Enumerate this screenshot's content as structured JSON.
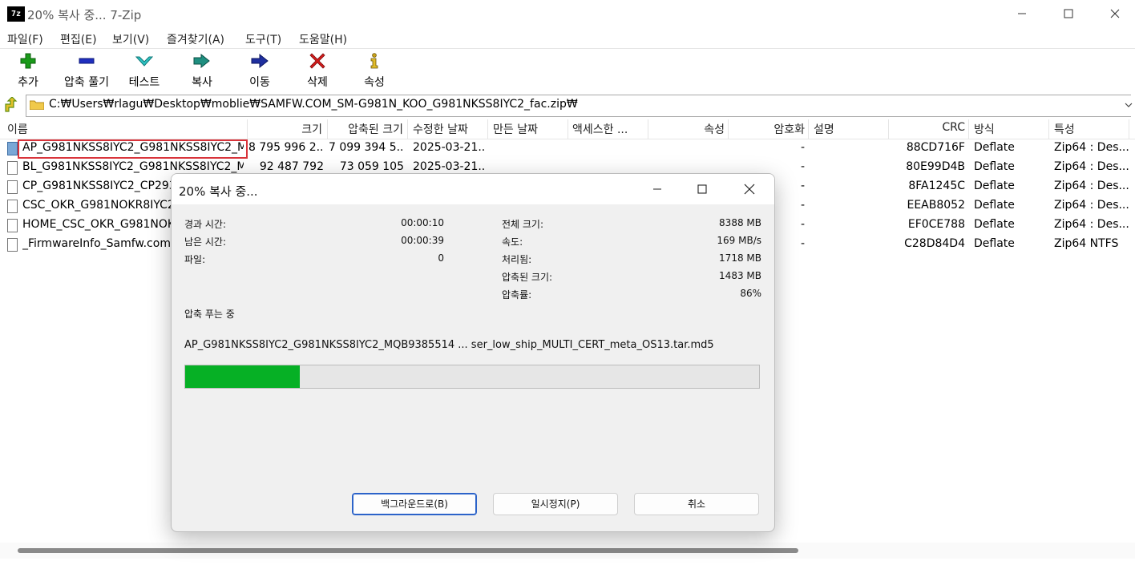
{
  "window": {
    "icon_text": "7z",
    "title": "20% 복사 중... 7-Zip"
  },
  "menu": [
    "파일(F)",
    "편집(E)",
    "보기(V)",
    "즐겨찾기(A)",
    "도구(T)",
    "도움말(H)"
  ],
  "toolbar": [
    {
      "label": "추가",
      "icon": "plus-icon",
      "color": "#1a9a1a"
    },
    {
      "label": "압축 풀기",
      "icon": "minus-icon",
      "color": "#1f2fbf"
    },
    {
      "label": "테스트",
      "icon": "check-icon",
      "color": "#25b5b5"
    },
    {
      "label": "복사",
      "icon": "double-arrow-icon",
      "color": "#1f8f80"
    },
    {
      "label": "이동",
      "icon": "arrow-right-icon",
      "color": "#1f2f9f"
    },
    {
      "label": "삭제",
      "icon": "x-icon",
      "color": "#d51b1b"
    },
    {
      "label": "속성",
      "icon": "info-icon",
      "color": "#c9a21a"
    }
  ],
  "address": {
    "path": "C:₩Users₩rlagu₩Desktop₩moblie₩SAMFW.COM_SM-G981N_KOO_G981NKSS8IYC2_fac.zip₩"
  },
  "columns": [
    "이름",
    "크기",
    "압축된 크기",
    "수정한 날짜",
    "만든 날짜",
    "액세스한 ...",
    "속성",
    "암호화",
    "설명",
    "CRC",
    "방식",
    "특성"
  ],
  "files": [
    {
      "name": "AP_G981NKSS8IYC2_G981NKSS8IYC2_M...",
      "size": "8 795 996 2...",
      "packed": "7 099 394 5...",
      "modified": "2025-03-21...",
      "encrypted": "-",
      "crc": "88CD716F",
      "method": "Deflate",
      "characteristics": "Zip64 : Des..."
    },
    {
      "name": "BL_G981NKSS8IYC2_G981NKSS8IYC2_M...",
      "size": "92 487 792",
      "packed": "73 059 105",
      "modified": "2025-03-21...",
      "encrypted": "-",
      "crc": "80E99D4B",
      "method": "Deflate",
      "characteristics": "Zip64 : Des..."
    },
    {
      "name": "CP_G981NKSS8IYC2_CP29397",
      "size": "",
      "packed": "",
      "modified": "",
      "encrypted": "-",
      "crc": "8FA1245C",
      "method": "Deflate",
      "characteristics": "Zip64 : Des..."
    },
    {
      "name": "CSC_OKR_G981NOKR8IYC2_",
      "size": "",
      "packed": "",
      "modified": "",
      "encrypted": "-",
      "crc": "EEAB8052",
      "method": "Deflate",
      "characteristics": "Zip64 : Des..."
    },
    {
      "name": "HOME_CSC_OKR_G981NOKR",
      "size": "",
      "packed": "",
      "modified": "",
      "encrypted": "-",
      "crc": "EF0CE788",
      "method": "Deflate",
      "characteristics": "Zip64 : Des..."
    },
    {
      "name": "_FirmwareInfo_Samfw.com.txt",
      "size": "",
      "packed": "",
      "modified": "",
      "encrypted": "-",
      "crc": "C28D84D4",
      "method": "Deflate",
      "characteristics": "Zip64 NTFS"
    }
  ],
  "dialog": {
    "title": "20% 복사 중...",
    "left_stats": [
      {
        "label": "경과 시간:",
        "value": "00:00:10"
      },
      {
        "label": "남은 시간:",
        "value": "00:00:39"
      },
      {
        "label": "파일:",
        "value": "0"
      }
    ],
    "right_stats": [
      {
        "label": "전체 크기:",
        "value": "8388 MB"
      },
      {
        "label": "속도:",
        "value": "169 MB/s"
      },
      {
        "label": "처리됨:",
        "value": "1718 MB"
      },
      {
        "label": "압축된 크기:",
        "value": "1483 MB"
      },
      {
        "label": "압축률:",
        "value": "86%"
      }
    ],
    "status": "압축 푸는 중",
    "current_file": "AP_G981NKSS8IYC2_G981NKSS8IYC2_MQB9385514 ... ser_low_ship_MULTI_CERT_meta_OS13.tar.md5",
    "progress_fraction": 0.2,
    "buttons": {
      "background": "백그라운드로(B)",
      "pause": "일시정지(P)",
      "cancel": "취소"
    },
    "progress_color": "#06b025"
  }
}
